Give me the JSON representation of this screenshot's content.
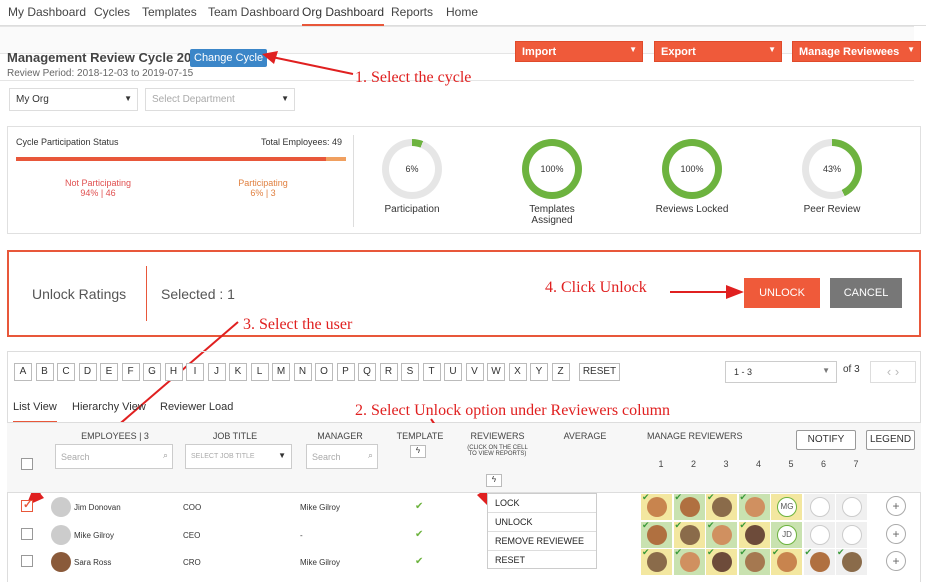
{
  "nav": {
    "items": [
      "My Dashboard",
      "Cycles",
      "Templates",
      "Team Dashboard",
      "Org Dashboard",
      "Reports",
      "Home"
    ],
    "active": "Org Dashboard"
  },
  "header": {
    "cycle_title": "Management Review Cycle 2019",
    "change_cycle": "Change Cycle",
    "period": "Review Period: 2018-12-03 to 2019-07-15"
  },
  "actions": {
    "import": "Import",
    "export": "Export",
    "manage": "Manage Reviewees"
  },
  "filters": {
    "org": "My Org",
    "dept_placeholder": "Select Department"
  },
  "status": {
    "title": "Cycle Participation Status",
    "total": "Total Employees: 49",
    "not_label": "Not Participating",
    "not_value": "94% | 46",
    "part_label": "Participating",
    "part_value": "6% | 3",
    "participating_pct": 6
  },
  "donuts": [
    {
      "value": "6%",
      "label": "Participation",
      "pct": 6
    },
    {
      "value": "100%",
      "label": "Templates\nAssigned",
      "pct": 100
    },
    {
      "value": "100%",
      "label": "Reviews Locked",
      "pct": 100
    },
    {
      "value": "43%",
      "label": "Peer Review",
      "pct": 43
    }
  ],
  "unlock": {
    "title": "Unlock Ratings",
    "selected": "Selected : 1",
    "unlock_btn": "UNLOCK",
    "cancel_btn": "CANCEL"
  },
  "annotations": {
    "a1": "1. Select the cycle",
    "a2": "2. Select Unlock option under Reviewers column",
    "a3": "3. Select the user",
    "a4": "4. Click Unlock"
  },
  "alphabet": [
    "A",
    "B",
    "C",
    "D",
    "E",
    "F",
    "G",
    "H",
    "I",
    "J",
    "K",
    "L",
    "M",
    "N",
    "O",
    "P",
    "Q",
    "R",
    "S",
    "T",
    "U",
    "V",
    "W",
    "X",
    "Y",
    "Z"
  ],
  "reset": "RESET",
  "pager": {
    "range": "1 - 3",
    "of": "of 3"
  },
  "tabs": [
    "List View",
    "Hierarchy View",
    "Reviewer Load"
  ],
  "table": {
    "headers": {
      "employees": "EMPLOYEES | 3",
      "job": "JOB TITLE",
      "manager": "MANAGER",
      "template": "TEMPLATE",
      "reviewers": "REVIEWERS",
      "reviewers_note": "(CLICK ON THE CELL TO VIEW REPORTS)",
      "average": "AVERAGE",
      "manage": "MANAGE REVIEWERS"
    },
    "search_placeholder": "Search",
    "job_placeholder": "SELECT JOB TITLE",
    "manager_placeholder": "Search",
    "notify": "NOTIFY",
    "legend": "LEGEND",
    "cols": [
      "1",
      "2",
      "3",
      "4",
      "5",
      "6",
      "7"
    ],
    "rows": [
      {
        "name": "Jim Donovan",
        "job": "COO",
        "manager": "Mike Gilroy",
        "checked": true,
        "initials": "MG"
      },
      {
        "name": "Mike Gilroy",
        "job": "CEO",
        "manager": "-",
        "checked": false,
        "initials": "JD"
      },
      {
        "name": "Sara Ross",
        "job": "CRO",
        "manager": "Mike Gilroy",
        "checked": false,
        "initials": ""
      }
    ]
  },
  "menu": [
    "LOCK",
    "UNLOCK",
    "REMOVE REVIEWEE",
    "RESET"
  ],
  "colors": {
    "accent": "#ef5a3a",
    "blue": "#3b86c8",
    "green": "#6db33f"
  }
}
